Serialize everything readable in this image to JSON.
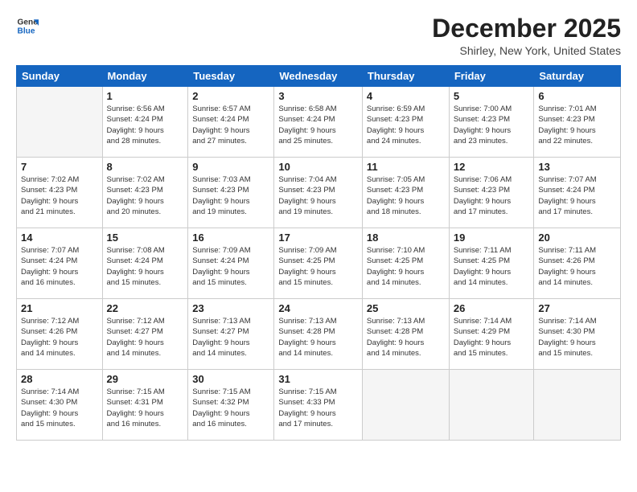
{
  "logo": {
    "line1": "General",
    "line2": "Blue"
  },
  "title": "December 2025",
  "location": "Shirley, New York, United States",
  "days_of_week": [
    "Sunday",
    "Monday",
    "Tuesday",
    "Wednesday",
    "Thursday",
    "Friday",
    "Saturday"
  ],
  "weeks": [
    [
      {
        "day": "",
        "info": ""
      },
      {
        "day": "1",
        "info": "Sunrise: 6:56 AM\nSunset: 4:24 PM\nDaylight: 9 hours\nand 28 minutes."
      },
      {
        "day": "2",
        "info": "Sunrise: 6:57 AM\nSunset: 4:24 PM\nDaylight: 9 hours\nand 27 minutes."
      },
      {
        "day": "3",
        "info": "Sunrise: 6:58 AM\nSunset: 4:24 PM\nDaylight: 9 hours\nand 25 minutes."
      },
      {
        "day": "4",
        "info": "Sunrise: 6:59 AM\nSunset: 4:23 PM\nDaylight: 9 hours\nand 24 minutes."
      },
      {
        "day": "5",
        "info": "Sunrise: 7:00 AM\nSunset: 4:23 PM\nDaylight: 9 hours\nand 23 minutes."
      },
      {
        "day": "6",
        "info": "Sunrise: 7:01 AM\nSunset: 4:23 PM\nDaylight: 9 hours\nand 22 minutes."
      }
    ],
    [
      {
        "day": "7",
        "info": "Sunrise: 7:02 AM\nSunset: 4:23 PM\nDaylight: 9 hours\nand 21 minutes."
      },
      {
        "day": "8",
        "info": "Sunrise: 7:02 AM\nSunset: 4:23 PM\nDaylight: 9 hours\nand 20 minutes."
      },
      {
        "day": "9",
        "info": "Sunrise: 7:03 AM\nSunset: 4:23 PM\nDaylight: 9 hours\nand 19 minutes."
      },
      {
        "day": "10",
        "info": "Sunrise: 7:04 AM\nSunset: 4:23 PM\nDaylight: 9 hours\nand 19 minutes."
      },
      {
        "day": "11",
        "info": "Sunrise: 7:05 AM\nSunset: 4:23 PM\nDaylight: 9 hours\nand 18 minutes."
      },
      {
        "day": "12",
        "info": "Sunrise: 7:06 AM\nSunset: 4:23 PM\nDaylight: 9 hours\nand 17 minutes."
      },
      {
        "day": "13",
        "info": "Sunrise: 7:07 AM\nSunset: 4:24 PM\nDaylight: 9 hours\nand 17 minutes."
      }
    ],
    [
      {
        "day": "14",
        "info": "Sunrise: 7:07 AM\nSunset: 4:24 PM\nDaylight: 9 hours\nand 16 minutes."
      },
      {
        "day": "15",
        "info": "Sunrise: 7:08 AM\nSunset: 4:24 PM\nDaylight: 9 hours\nand 15 minutes."
      },
      {
        "day": "16",
        "info": "Sunrise: 7:09 AM\nSunset: 4:24 PM\nDaylight: 9 hours\nand 15 minutes."
      },
      {
        "day": "17",
        "info": "Sunrise: 7:09 AM\nSunset: 4:25 PM\nDaylight: 9 hours\nand 15 minutes."
      },
      {
        "day": "18",
        "info": "Sunrise: 7:10 AM\nSunset: 4:25 PM\nDaylight: 9 hours\nand 14 minutes."
      },
      {
        "day": "19",
        "info": "Sunrise: 7:11 AM\nSunset: 4:25 PM\nDaylight: 9 hours\nand 14 minutes."
      },
      {
        "day": "20",
        "info": "Sunrise: 7:11 AM\nSunset: 4:26 PM\nDaylight: 9 hours\nand 14 minutes."
      }
    ],
    [
      {
        "day": "21",
        "info": "Sunrise: 7:12 AM\nSunset: 4:26 PM\nDaylight: 9 hours\nand 14 minutes."
      },
      {
        "day": "22",
        "info": "Sunrise: 7:12 AM\nSunset: 4:27 PM\nDaylight: 9 hours\nand 14 minutes."
      },
      {
        "day": "23",
        "info": "Sunrise: 7:13 AM\nSunset: 4:27 PM\nDaylight: 9 hours\nand 14 minutes."
      },
      {
        "day": "24",
        "info": "Sunrise: 7:13 AM\nSunset: 4:28 PM\nDaylight: 9 hours\nand 14 minutes."
      },
      {
        "day": "25",
        "info": "Sunrise: 7:13 AM\nSunset: 4:28 PM\nDaylight: 9 hours\nand 14 minutes."
      },
      {
        "day": "26",
        "info": "Sunrise: 7:14 AM\nSunset: 4:29 PM\nDaylight: 9 hours\nand 15 minutes."
      },
      {
        "day": "27",
        "info": "Sunrise: 7:14 AM\nSunset: 4:30 PM\nDaylight: 9 hours\nand 15 minutes."
      }
    ],
    [
      {
        "day": "28",
        "info": "Sunrise: 7:14 AM\nSunset: 4:30 PM\nDaylight: 9 hours\nand 15 minutes."
      },
      {
        "day": "29",
        "info": "Sunrise: 7:15 AM\nSunset: 4:31 PM\nDaylight: 9 hours\nand 16 minutes."
      },
      {
        "day": "30",
        "info": "Sunrise: 7:15 AM\nSunset: 4:32 PM\nDaylight: 9 hours\nand 16 minutes."
      },
      {
        "day": "31",
        "info": "Sunrise: 7:15 AM\nSunset: 4:33 PM\nDaylight: 9 hours\nand 17 minutes."
      },
      {
        "day": "",
        "info": ""
      },
      {
        "day": "",
        "info": ""
      },
      {
        "day": "",
        "info": ""
      }
    ]
  ]
}
